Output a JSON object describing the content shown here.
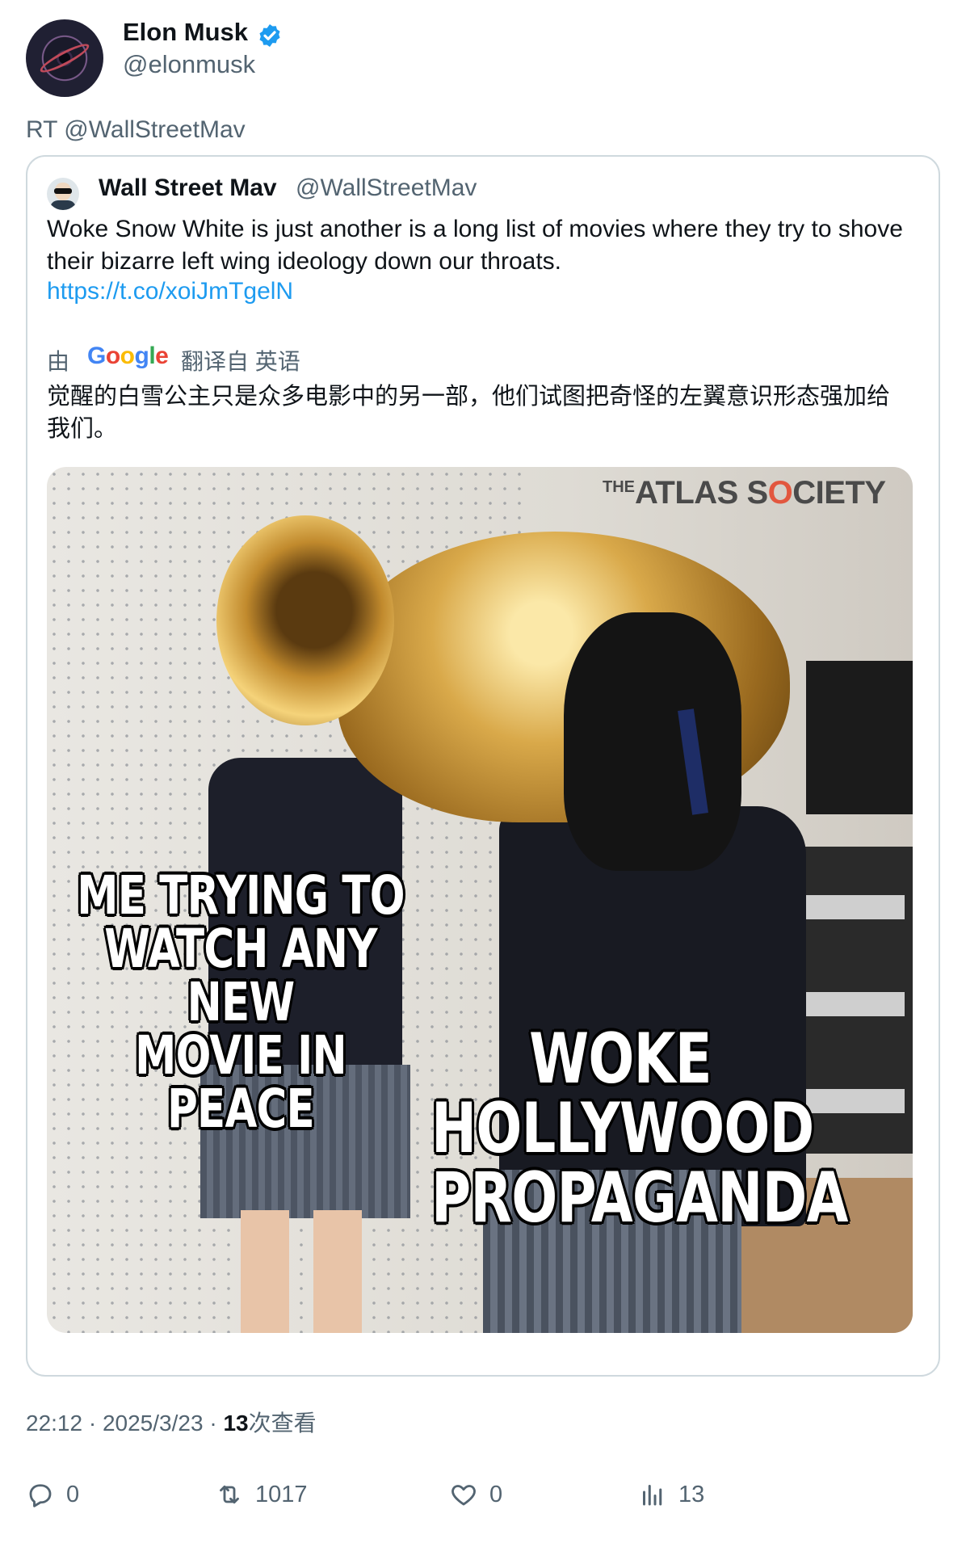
{
  "author": {
    "name": "Elon Musk",
    "handle": "@elonmusk",
    "verified": true,
    "avatar_icon": "black-hole-avatar"
  },
  "retweet_label": "RT @WallStreetMav",
  "quote": {
    "name": "Wall Street Mav",
    "handle": "@WallStreetMav",
    "avatar_icon": "sunglasses-man-avatar",
    "text": "Woke Snow White is just another is a long list of movies where they try to shove their bizarre left wing ideology down our throats.",
    "link": "https://t.co/xoiJmTgelN",
    "translation": {
      "by_label": "由",
      "provider": "Google",
      "from_label": "翻译自 英语",
      "text": "觉醒的白雪公主只是众多电影中的另一部，他们试图把奇怪的左翼意识形态强加给我们。"
    },
    "image": {
      "watermark_prefix": "THE",
      "watermark_part1": "ATLAS S",
      "watermark_o": "O",
      "watermark_part2": "CIETY",
      "caption_left_1": "ME TRYING TO",
      "caption_left_2": "WATCH ANY NEW",
      "caption_left_3": "MOVIE IN PEACE",
      "caption_right_1": "WOKE",
      "caption_right_2": "HOLLYWOOD",
      "caption_right_3": "PROPAGANDA"
    }
  },
  "meta": {
    "time": "22:12",
    "sep1": "·",
    "date": "2025/3/23",
    "sep2": "·",
    "views_count": "13",
    "views_label": "次查看"
  },
  "actions": {
    "reply": {
      "icon": "reply-icon",
      "count": "0"
    },
    "retweet": {
      "icon": "retweet-icon",
      "count": "1017"
    },
    "like": {
      "icon": "heart-icon",
      "count": "0"
    },
    "views": {
      "icon": "views-icon",
      "count": "13"
    }
  },
  "colors": {
    "accent": "#1d9bf0",
    "secondary_text": "#536471",
    "border": "#cfd9de"
  }
}
